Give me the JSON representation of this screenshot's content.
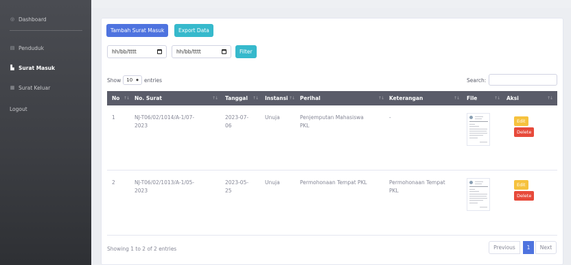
{
  "sidebar": {
    "items": [
      {
        "label": "Dashboard",
        "icon": "dashboard-icon"
      },
      {
        "label": "Penduduk",
        "icon": "table-icon"
      },
      {
        "label": "Surat Masuk",
        "icon": "chart-icon"
      },
      {
        "label": "Surat Keluar",
        "icon": "table-icon"
      },
      {
        "label": "Logout"
      }
    ]
  },
  "toolbar": {
    "add_label": "Tambah Surat Masuk",
    "export_label": "Export Data",
    "date_from_placeholder": "hh/bb/tttt",
    "date_to_placeholder": "hh/bb/tttt",
    "filter_label": "Filter"
  },
  "table_controls": {
    "show_label": "Show",
    "page_size": "10",
    "entries_label": "entries",
    "search_label": "Search:"
  },
  "table": {
    "headers": [
      "No",
      "No. Surat",
      "Tanggal",
      "Instansi",
      "Perihal",
      "Keterangan",
      "File",
      "Aksi"
    ],
    "rows": [
      {
        "no": "1",
        "no_surat_1": "NJ-T06/02/1014/A-1/07-",
        "no_surat_2": "2023",
        "tanggal_1": "2023-07-",
        "tanggal_2": "06",
        "instansi": "Unuja",
        "perihal_1": "Penjemputan Mahasiswa",
        "perihal_2": "PKL",
        "keterangan_1": "-",
        "keterangan_2": "",
        "edit_label": "Edit",
        "delete_label": "Delete"
      },
      {
        "no": "2",
        "no_surat_1": "NJ-T06/02/1013/A-1/05-",
        "no_surat_2": "2023",
        "tanggal_1": "2023-05-",
        "tanggal_2": "25",
        "instansi": "Unuja",
        "perihal_1": "Permohonaan Tempat PKL",
        "perihal_2": "",
        "keterangan_1": "Permohonaan Tempat",
        "keterangan_2": "PKL",
        "edit_label": "Edit",
        "delete_label": "Delete"
      }
    ]
  },
  "footer": {
    "info": "Showing 1 to 2 of 2 entries",
    "previous_label": "Previous",
    "current_page": "1",
    "next_label": "Next"
  },
  "colors": {
    "primary": "#4e73df",
    "info": "#36b9cc",
    "warning": "#f6c23e",
    "danger": "#e74a3b",
    "table_header": "#5a5c69"
  }
}
